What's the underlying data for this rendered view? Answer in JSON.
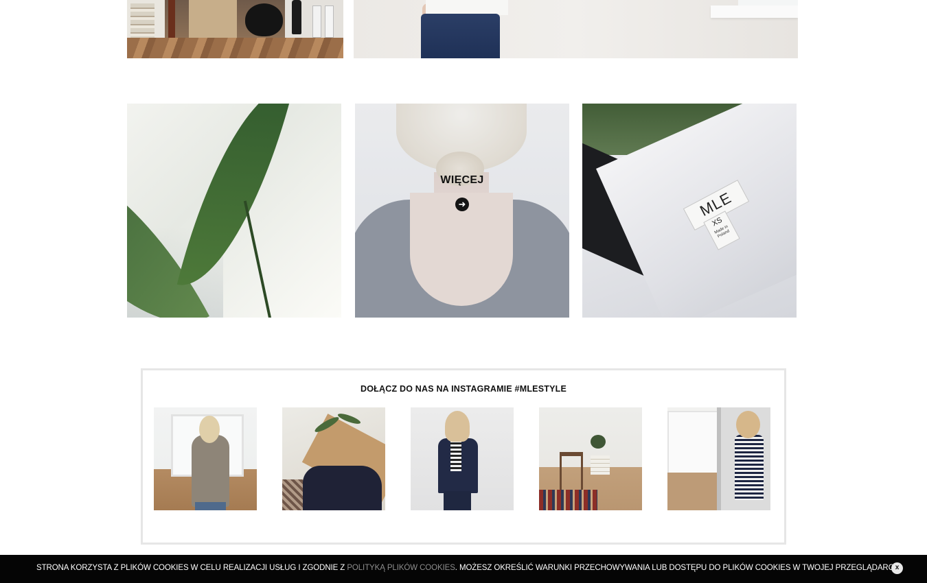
{
  "gallery": {
    "more_label": "WIĘCEJ",
    "tag_brand": "MLE",
    "tag_size": "XS",
    "tag_made": "Made in Poland"
  },
  "instagram": {
    "title": "DOŁĄCZ DO NAS NA INSTAGRAMIE #MLESTYLE"
  },
  "cookie_bar": {
    "text_before": "STRONA KORZYSTA Z PLIKÓW COOKIES W CELU REALIZACJI USŁUG I ZGODNIE Z ",
    "link_text": "POLITYKĄ PLIKÓW COOKIES",
    "text_after": ". MOŻESZ OKREŚLIĆ WARUNKI PRZECHOWYWANIA LUB DOSTĘPU DO PLIKÓW COOKIES W TWOJEJ PRZEGLĄDARCE.",
    "close_label": "x",
    "link_color": "#8d8d8d",
    "background": "#050505"
  },
  "icons": {
    "more_arrow": "arrow-right-circle-icon",
    "close": "close-icon"
  }
}
